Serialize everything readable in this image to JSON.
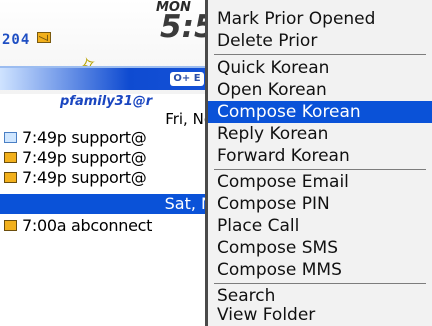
{
  "home": {
    "month_label": "MON",
    "clock": "5:5",
    "unread_count": "204",
    "account": "pfamily31@r",
    "banner_tab": "O+ E"
  },
  "messages": {
    "date_header": "Fri, No",
    "items": [
      {
        "time": "7:49p",
        "sender": "support@",
        "status": "read"
      },
      {
        "time": "7:49p",
        "sender": "support@",
        "status": "unread"
      },
      {
        "time": "7:49p",
        "sender": "support@",
        "status": "unread"
      },
      {
        "time": "7:00a",
        "sender": "abconnect",
        "status": "unread"
      }
    ],
    "selected_date": "Sat, N"
  },
  "menu": {
    "items": [
      {
        "label": "Mark Prior Opened"
      },
      {
        "label": "Delete Prior"
      },
      {
        "label": "Quick Korean"
      },
      {
        "label": "Open Korean"
      },
      {
        "label": "Compose Korean",
        "selected": true
      },
      {
        "label": "Reply Korean"
      },
      {
        "label": "Forward Korean"
      },
      {
        "label": "Compose Email"
      },
      {
        "label": "Compose PIN"
      },
      {
        "label": "Place Call"
      },
      {
        "label": "Compose SMS"
      },
      {
        "label": "Compose MMS"
      },
      {
        "label": "Search"
      },
      {
        "label": "View Folder"
      }
    ]
  },
  "colors": {
    "selection": "#0a52d8",
    "menu_bg": "#f2f2f2",
    "account_text": "#1a46c0",
    "envelope": "#f2b01c"
  }
}
